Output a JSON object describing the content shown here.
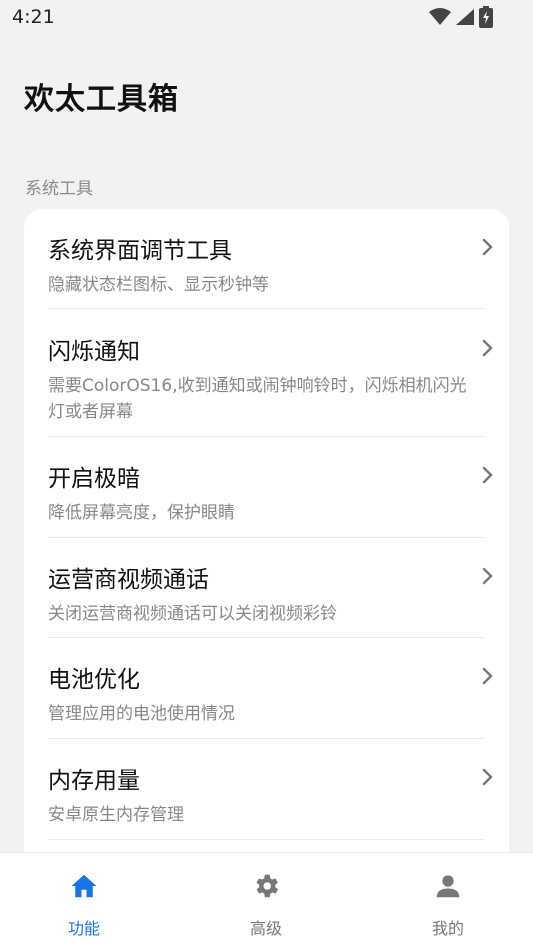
{
  "status_bar": {
    "time": "4:21"
  },
  "app": {
    "title": "欢太工具箱"
  },
  "section": {
    "label": "系统工具"
  },
  "items": [
    {
      "title": "系统界面调节工具",
      "subtitle": "隐藏状态栏图标、显示秒钟等"
    },
    {
      "title": "闪烁通知",
      "subtitle": "需要ColorOS16,收到通知或闹钟响铃时，闪烁相机闪光灯或者屏幕"
    },
    {
      "title": "开启极暗",
      "subtitle": "降低屏幕亮度，保护眼睛"
    },
    {
      "title": "运营商视频通话",
      "subtitle": "关闭运营商视频通话可以关闭视频彩铃"
    },
    {
      "title": "电池优化",
      "subtitle": "管理应用的电池使用情况"
    },
    {
      "title": "内存用量",
      "subtitle": "安卓原生内存管理"
    }
  ],
  "bottom_nav": [
    {
      "label": "功能",
      "icon": "home-icon",
      "active": true
    },
    {
      "label": "高级",
      "icon": "gear-icon",
      "active": false
    },
    {
      "label": "我的",
      "icon": "person-icon",
      "active": false
    }
  ],
  "colors": {
    "accent": "#1a73e8",
    "background": "#f2f2f4",
    "card": "#ffffff",
    "subtext": "#888888"
  }
}
